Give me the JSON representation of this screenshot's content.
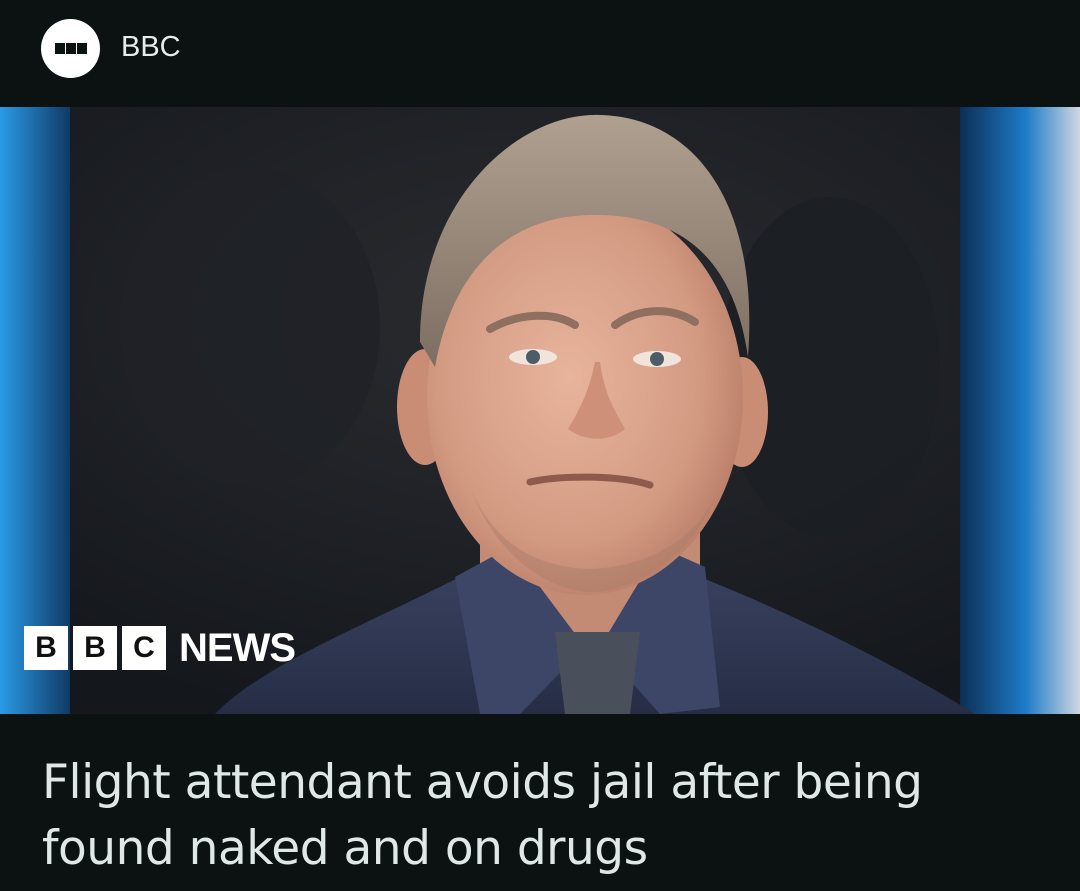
{
  "source": {
    "name": "BBC",
    "logo_icon": "bbc-blocks-icon"
  },
  "image": {
    "watermark_letters": [
      "B",
      "B",
      "C"
    ],
    "watermark_word": "NEWS",
    "colors": {
      "background_dark": "#15191f",
      "left_edge_blue": "#1f8bd8",
      "right_edge_blue": "#1d7cc8",
      "shirt": "#2c3552",
      "skin": "#d9a189",
      "hair": "#9c8c7c"
    }
  },
  "headline": "Flight attendant avoids jail after being found naked and on drugs",
  "colors": {
    "page_bg": "#0c1212",
    "headline_text": "#dfe8e6",
    "source_text": "#e6ecec"
  }
}
